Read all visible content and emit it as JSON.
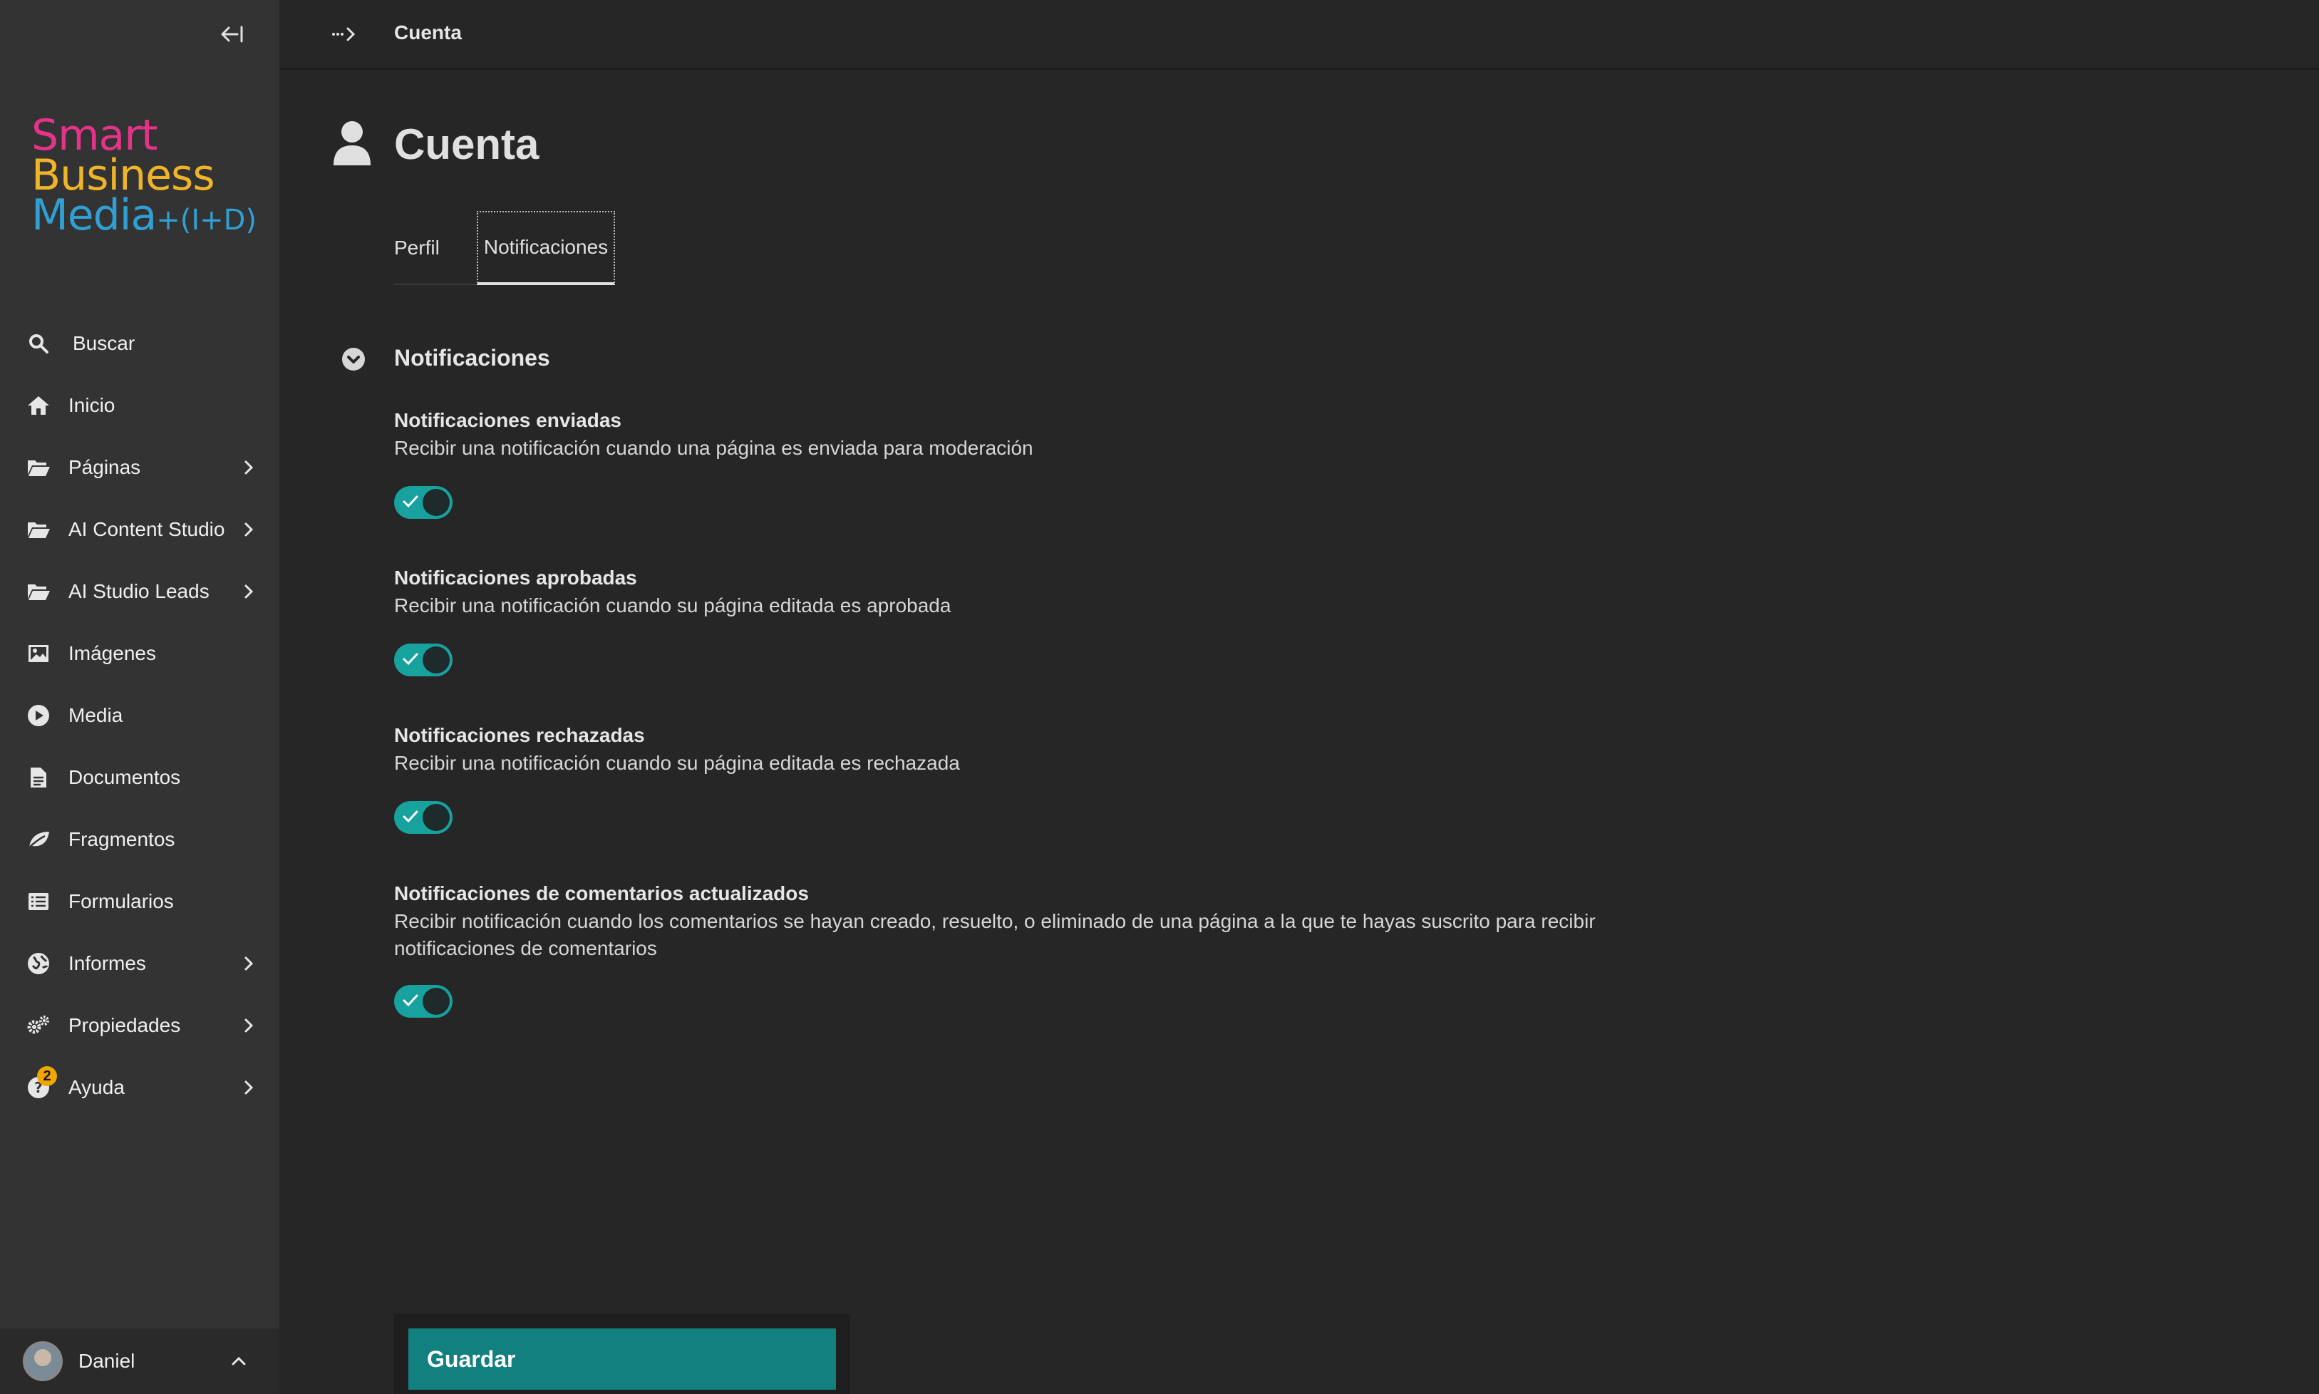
{
  "sidebar": {
    "collapse_icon": "collapse-left-icon",
    "logo": {
      "line1": "Smart",
      "line2": "Business",
      "line3": "Media",
      "suffix": "+(I+D)"
    },
    "search_label": "Buscar",
    "items": [
      {
        "label": "Inicio",
        "icon": "home-icon",
        "has_children": false
      },
      {
        "label": "Páginas",
        "icon": "folder-open-icon",
        "has_children": true
      },
      {
        "label": "AI Content Studio",
        "icon": "folder-open-icon",
        "has_children": true
      },
      {
        "label": "AI Studio Leads",
        "icon": "folder-open-icon",
        "has_children": true
      },
      {
        "label": "Imágenes",
        "icon": "image-icon",
        "has_children": false
      },
      {
        "label": "Media",
        "icon": "play-circle-icon",
        "has_children": false
      },
      {
        "label": "Documentos",
        "icon": "document-icon",
        "has_children": false
      },
      {
        "label": "Fragmentos",
        "icon": "leaf-icon",
        "has_children": false
      },
      {
        "label": "Formularios",
        "icon": "list-icon",
        "has_children": false
      },
      {
        "label": "Informes",
        "icon": "globe-icon",
        "has_children": true
      },
      {
        "label": "Propiedades",
        "icon": "cogs-icon",
        "has_children": true
      },
      {
        "label": "Ayuda",
        "icon": "help-icon",
        "has_children": true,
        "badge": "2"
      }
    ],
    "user": {
      "name": "Daniel"
    }
  },
  "header": {
    "breadcrumb_title": "Cuenta"
  },
  "page": {
    "title": "Cuenta",
    "tabs": [
      {
        "label": "Perfil",
        "active": false
      },
      {
        "label": "Notificaciones",
        "active": true
      }
    ],
    "section_title": "Notificaciones",
    "settings": [
      {
        "title": "Notificaciones enviadas",
        "description": "Recibir una notificación cuando una página es enviada para moderación",
        "enabled": true
      },
      {
        "title": "Notificaciones aprobadas",
        "description": "Recibir una notificación cuando su página editada es aprobada",
        "enabled": true
      },
      {
        "title": "Notificaciones rechazadas",
        "description": "Recibir una notificación cuando su página editada es rechazada",
        "enabled": true
      },
      {
        "title": "Notificaciones de comentarios actualizados",
        "description": "Recibir notificación cuando los comentarios se hayan creado, resuelto, o eliminado de una página a la que te hayas suscrito para recibir notificaciones de comentarios",
        "enabled": true
      }
    ],
    "save_label": "Guardar"
  },
  "colors": {
    "accent": "#17a2a0",
    "save_button": "#138080",
    "sidebar_bg": "#333333",
    "main_bg": "#262626"
  }
}
